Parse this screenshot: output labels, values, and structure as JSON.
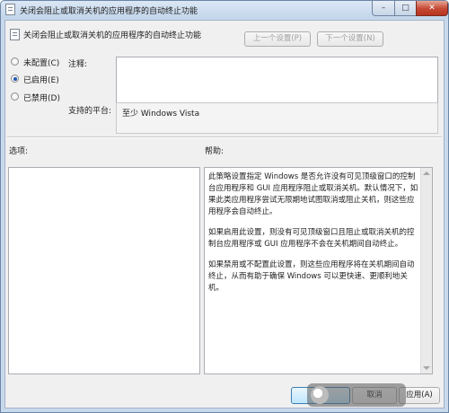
{
  "window": {
    "title": "关闭会阻止或取消关机的应用程序的自动终止功能",
    "controls": {
      "minimize": "–",
      "maximize": "□",
      "close": "✕"
    }
  },
  "header": {
    "policy_title": "关闭会阻止或取消关机的应用程序的自动终止功能",
    "prev_label": "上一个设置(P)",
    "next_label": "下一个设置(N)"
  },
  "state": {
    "options": [
      {
        "label": "未配置(C)",
        "checked": false
      },
      {
        "label": "已启用(E)",
        "checked": true
      },
      {
        "label": "已禁用(D)",
        "checked": false
      }
    ]
  },
  "labels": {
    "notes": "注释:",
    "supported": "支持的平台:",
    "options": "选项:",
    "help": "帮助:"
  },
  "notes_value": "",
  "supported_value": "至少 Windows Vista",
  "help_text": [
    "此策略设置指定 Windows 是否允许没有可见顶级窗口的控制台应用程序和 GUI 应用程序阻止或取消关机。默认情况下，如果此类应用程序尝试无限期地试图取消或阻止关机，则这些应用程序会自动终止。",
    "如果启用此设置，则没有可见顶级窗口且阻止或取消关机的控制台应用程序或 GUI 应用程序不会在关机期间自动终止。",
    "如果禁用或不配置此设置，则这些应用程序将在关机期间自动终止，从而有助于确保 Windows 可以更快速、更顺利地关机。"
  ],
  "footer": {
    "ok_label": "确定",
    "cancel_label": "取消",
    "apply_label": "应用(A)"
  }
}
